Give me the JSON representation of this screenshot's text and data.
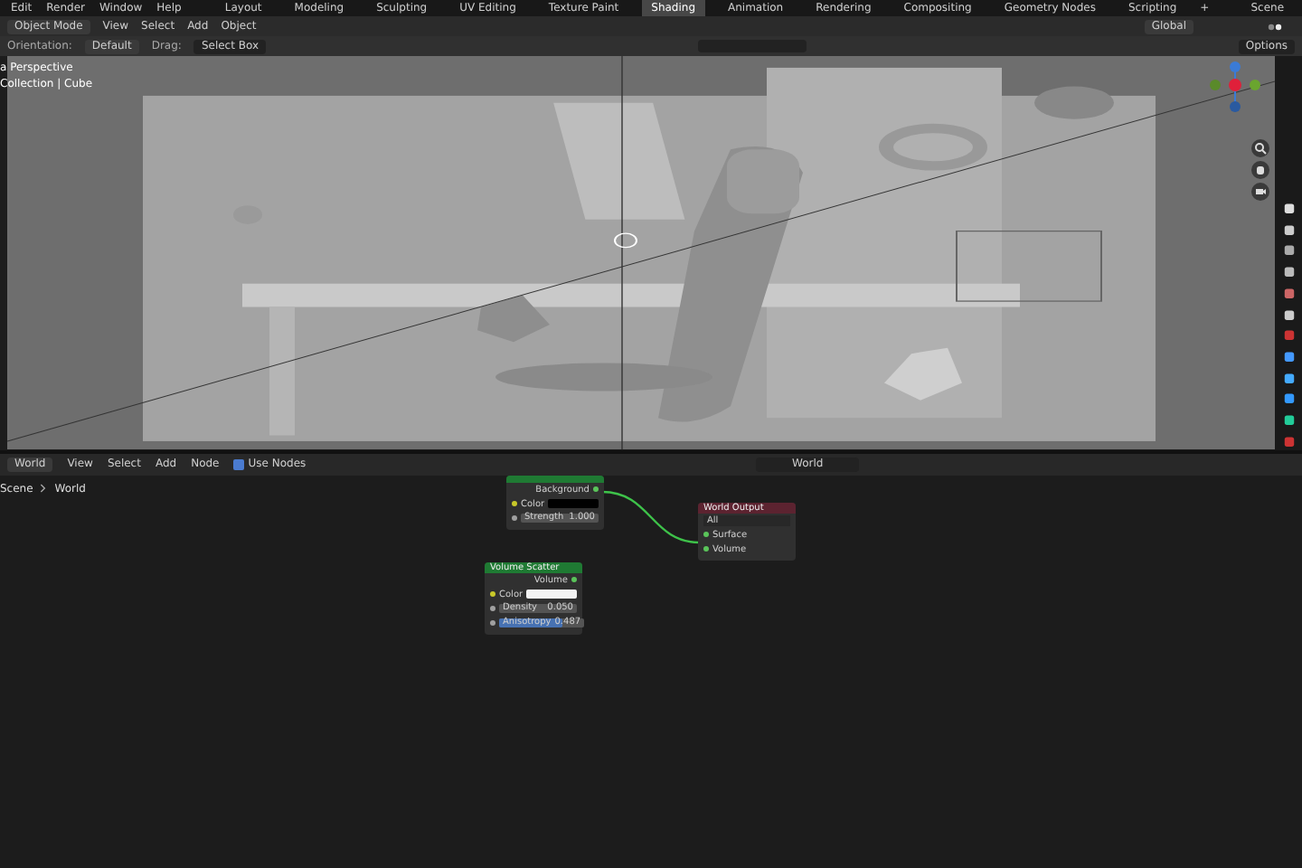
{
  "top_bar": {
    "menus": [
      "Edit",
      "Render",
      "Window",
      "Help"
    ],
    "workspaces": [
      {
        "label": "Layout",
        "selected": false
      },
      {
        "label": "Modeling",
        "selected": false
      },
      {
        "label": "Sculpting",
        "selected": false
      },
      {
        "label": "UV Editing",
        "selected": false
      },
      {
        "label": "Texture Paint",
        "selected": false
      },
      {
        "label": "Shading",
        "selected": true
      },
      {
        "label": "Animation",
        "selected": false
      },
      {
        "label": "Rendering",
        "selected": false
      },
      {
        "label": "Compositing",
        "selected": false
      },
      {
        "label": "Geometry Nodes",
        "selected": false
      },
      {
        "label": "Scripting",
        "selected": false
      }
    ],
    "add": "+",
    "scene": "Scene"
  },
  "viewport_header": {
    "mode": "Object Mode",
    "menus": [
      "View",
      "Select",
      "Add",
      "Object"
    ],
    "orientation": "Global"
  },
  "tool_settings": {
    "orientation_label": "Orientation:",
    "orientation": "Default",
    "drag_label": "Drag:",
    "drag": "Select Box",
    "options": "Options"
  },
  "viewport": {
    "view_name": "a Perspective",
    "collection": "Collection | Cube"
  },
  "node_editor": {
    "header": {
      "editor": "World",
      "menus": [
        "View",
        "Select",
        "Add",
        "Node"
      ],
      "use_nodes": {
        "label": "Use Nodes",
        "checked": true
      },
      "world": "World"
    },
    "breadcrumb": [
      "Scene",
      "World"
    ],
    "nodes": [
      {
        "color": "#1f7a33",
        "outputs": [
          "Background"
        ],
        "inputs": [
          {
            "kind": "color",
            "label": "Color",
            "color": "#000000"
          },
          {
            "kind": "value",
            "label": "Strength",
            "value": "1.000"
          }
        ]
      },
      {
        "title": "World Output",
        "color": "#5c2330",
        "select": "All",
        "inputs": [
          {
            "kind": "socket",
            "label": "Surface"
          },
          {
            "kind": "socket",
            "label": "Volume"
          }
        ]
      },
      {
        "title": "Volume Scatter",
        "color": "#1f7a33",
        "outputs": [
          "Volume"
        ],
        "inputs": [
          {
            "kind": "color",
            "label": "Color",
            "color": "#f2f2f2"
          },
          {
            "kind": "value",
            "label": "Density",
            "value": "0.050"
          },
          {
            "kind": "slider",
            "label": "Anisotropy",
            "value": "0.487",
            "level": 0.75
          }
        ]
      }
    ]
  }
}
